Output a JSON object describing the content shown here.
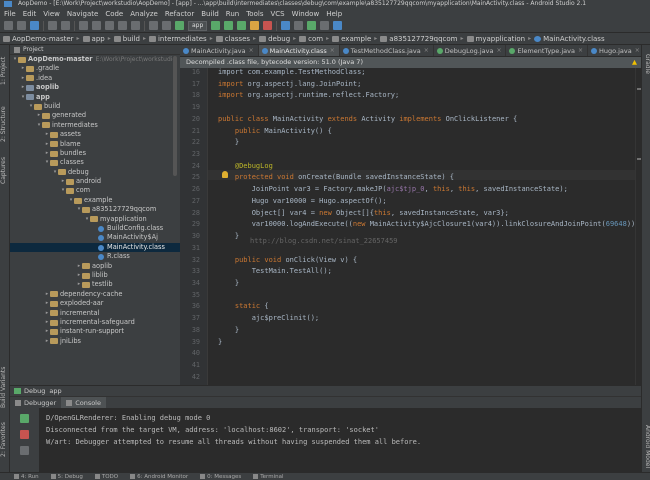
{
  "window": {
    "title": "AopDemo - [E:\\Work\\Project\\workstudio\\AopDemo] - [app] - ...\\app\\build\\intermediates\\classes\\debug\\com\\example\\a835127729qqcom\\myapplication\\MainActivity.class - Android Studio 2.1"
  },
  "menu": [
    "File",
    "Edit",
    "View",
    "Navigate",
    "Code",
    "Analyze",
    "Refactor",
    "Build",
    "Run",
    "Tools",
    "VCS",
    "Window",
    "Help"
  ],
  "toolbar": {
    "run_config": "app"
  },
  "breadcrumb": [
    {
      "label": "AopDemo-master",
      "icon": "folder-icon"
    },
    {
      "label": "app",
      "icon": "module-icon"
    },
    {
      "label": "build",
      "icon": "folder-icon"
    },
    {
      "label": "intermediates",
      "icon": "folder-icon"
    },
    {
      "label": "classes",
      "icon": "folder-icon"
    },
    {
      "label": "debug",
      "icon": "folder-icon"
    },
    {
      "label": "com",
      "icon": "folder-icon"
    },
    {
      "label": "example",
      "icon": "folder-icon"
    },
    {
      "label": "a835127729qqcom",
      "icon": "folder-icon"
    },
    {
      "label": "myapplication",
      "icon": "folder-icon"
    },
    {
      "label": "MainActivity.class",
      "icon": "class-icon"
    }
  ],
  "left_strip": {
    "tabs": [
      "1: Project",
      "2: Structure",
      "Captures",
      "Build Variants",
      "2: Favorites"
    ]
  },
  "right_strip": {
    "tabs": [
      "Gradle",
      "Android Model"
    ]
  },
  "project": {
    "header": "Project",
    "tree": [
      {
        "label": "AopDemo-master",
        "extra": "E:\\Work\\Project\\workstudio",
        "depth": 0,
        "open": true,
        "icon": "folder-icon"
      },
      {
        "label": ".gradle",
        "depth": 1,
        "open": false,
        "icon": "folder-icon"
      },
      {
        "label": ".idea",
        "depth": 1,
        "open": false,
        "icon": "folder-icon"
      },
      {
        "label": "aoplib",
        "depth": 1,
        "open": false,
        "icon": "module-icon"
      },
      {
        "label": "app",
        "depth": 1,
        "open": true,
        "icon": "module-icon"
      },
      {
        "label": "build",
        "depth": 2,
        "open": true,
        "icon": "folder-icon"
      },
      {
        "label": "generated",
        "depth": 3,
        "open": false,
        "icon": "folder-icon"
      },
      {
        "label": "intermediates",
        "depth": 3,
        "open": true,
        "icon": "folder-icon"
      },
      {
        "label": "assets",
        "depth": 4,
        "open": false,
        "icon": "folder-icon"
      },
      {
        "label": "blame",
        "depth": 4,
        "open": false,
        "icon": "folder-icon"
      },
      {
        "label": "bundles",
        "depth": 4,
        "open": false,
        "icon": "folder-icon"
      },
      {
        "label": "classes",
        "depth": 4,
        "open": true,
        "icon": "folder-icon"
      },
      {
        "label": "debug",
        "depth": 5,
        "open": true,
        "icon": "folder-icon"
      },
      {
        "label": "android",
        "depth": 6,
        "open": false,
        "icon": "folder-icon"
      },
      {
        "label": "com",
        "depth": 6,
        "open": true,
        "icon": "folder-icon"
      },
      {
        "label": "example",
        "depth": 7,
        "open": true,
        "icon": "folder-icon"
      },
      {
        "label": "a835127729qqcom",
        "depth": 8,
        "open": true,
        "icon": "folder-icon"
      },
      {
        "label": "myapplication",
        "depth": 9,
        "open": true,
        "icon": "folder-icon"
      },
      {
        "label": "BuildConfig.class",
        "depth": 10,
        "leaf": true,
        "icon": "class-icon"
      },
      {
        "label": "MainActivity$Aj",
        "depth": 10,
        "leaf": true,
        "icon": "class-icon"
      },
      {
        "label": "MainActivity.class",
        "depth": 10,
        "leaf": true,
        "icon": "class-icon",
        "selected": true
      },
      {
        "label": "R.class",
        "depth": 10,
        "leaf": true,
        "icon": "class-icon"
      },
      {
        "label": "aoplib",
        "depth": 8,
        "open": false,
        "icon": "folder-icon"
      },
      {
        "label": "liblib",
        "depth": 8,
        "open": false,
        "icon": "folder-icon"
      },
      {
        "label": "testlib",
        "depth": 8,
        "open": false,
        "icon": "folder-icon"
      },
      {
        "label": "dependency-cache",
        "depth": 4,
        "open": false,
        "icon": "folder-icon"
      },
      {
        "label": "exploded-aar",
        "depth": 4,
        "open": false,
        "icon": "folder-icon"
      },
      {
        "label": "incremental",
        "depth": 4,
        "open": false,
        "icon": "folder-icon"
      },
      {
        "label": "incremental-safeguard",
        "depth": 4,
        "open": false,
        "icon": "folder-icon"
      },
      {
        "label": "instant-run-support",
        "depth": 4,
        "open": false,
        "icon": "folder-icon"
      },
      {
        "label": "jniLibs",
        "depth": 4,
        "open": false,
        "icon": "folder-icon"
      }
    ]
  },
  "editor": {
    "tabs": [
      {
        "label": "MainActivity.java",
        "active": false,
        "color": "#4a88c7"
      },
      {
        "label": "MainActivity.class",
        "active": true,
        "color": "#4a88c7"
      },
      {
        "label": "TestMethodClass.java",
        "active": false,
        "color": "#4a88c7"
      },
      {
        "label": "DebugLog.java",
        "active": false,
        "color": "#59a869"
      },
      {
        "label": "ElementType.java",
        "active": false,
        "color": "#59a869"
      },
      {
        "label": "Hugo.java",
        "active": false,
        "color": "#4a88c7"
      }
    ],
    "notice": "Decompiled .class file, bytecode version: 51.0 (Java 7)",
    "line_numbers": [
      "16",
      "17",
      "18",
      "19",
      "20",
      "21",
      "22",
      "23",
      "24",
      "25",
      "26",
      "27",
      "28",
      "29",
      "30",
      "31",
      "32",
      "33",
      "34",
      "35",
      "36",
      "37",
      "38",
      "39",
      "40",
      "41",
      "42"
    ],
    "code_lines": [
      [
        {
          "t": "import com.example.TestMethodClass;",
          "c": ""
        }
      ],
      [
        {
          "t": "import ",
          "c": "kw"
        },
        {
          "t": "org.aspectj.lang.JoinPoint;",
          "c": ""
        }
      ],
      [
        {
          "t": "import ",
          "c": "kw"
        },
        {
          "t": "org.aspectj.runtime.reflect.Factory;",
          "c": ""
        }
      ],
      [],
      [
        {
          "t": "public class ",
          "c": "kw"
        },
        {
          "t": "MainActivity ",
          "c": ""
        },
        {
          "t": "extends ",
          "c": "kw"
        },
        {
          "t": "Activity ",
          "c": ""
        },
        {
          "t": "implements ",
          "c": "kw"
        },
        {
          "t": "OnClickListener {",
          "c": ""
        }
      ],
      [
        {
          "t": "    public ",
          "c": "kw"
        },
        {
          "t": "MainActivity() {",
          "c": ""
        }
      ],
      [
        {
          "t": "    }",
          "c": ""
        }
      ],
      [],
      [
        {
          "t": "    @DebugLog",
          "c": "an"
        }
      ],
      [
        {
          "t": "    protected void ",
          "c": "kw"
        },
        {
          "t": "onCreate(Bundle savedInstanceState) {",
          "c": ""
        }
      ],
      [
        {
          "t": "        JoinPoint var3 = Factory.makeJP(",
          "c": ""
        },
        {
          "t": "ajc$tjp_0",
          "c": "fld"
        },
        {
          "t": ", ",
          "c": ""
        },
        {
          "t": "this",
          "c": "kw"
        },
        {
          "t": ", ",
          "c": ""
        },
        {
          "t": "this",
          "c": "kw"
        },
        {
          "t": ", savedInstanceState);",
          "c": ""
        }
      ],
      [
        {
          "t": "        Hugo var10000 = Hugo.aspectOf();",
          "c": ""
        }
      ],
      [
        {
          "t": "        Object[] var4 = ",
          "c": ""
        },
        {
          "t": "new ",
          "c": "kw"
        },
        {
          "t": "Object[]{",
          "c": ""
        },
        {
          "t": "this",
          "c": "kw"
        },
        {
          "t": ", savedInstanceState, var3};",
          "c": ""
        }
      ],
      [
        {
          "t": "        var10000.logAndExecute((",
          "c": ""
        },
        {
          "t": "new ",
          "c": "kw"
        },
        {
          "t": "MainActivity$AjcClosure1(var4)).linkClosureAndJoinPoint(",
          "c": ""
        },
        {
          "t": "69648",
          "c": "num"
        },
        {
          "t": "));",
          "c": ""
        }
      ],
      [
        {
          "t": "    }",
          "c": ""
        }
      ],
      [],
      [
        {
          "t": "    public void ",
          "c": "kw"
        },
        {
          "t": "onClick(View v) {",
          "c": ""
        }
      ],
      [
        {
          "t": "        TestMain.TestAll();",
          "c": ""
        }
      ],
      [
        {
          "t": "    }",
          "c": ""
        }
      ],
      [],
      [
        {
          "t": "    static ",
          "c": "kw"
        },
        {
          "t": "{",
          "c": ""
        }
      ],
      [
        {
          "t": "        ajc$preClinit();",
          "c": ""
        }
      ],
      [
        {
          "t": "    }",
          "c": ""
        }
      ],
      [
        {
          "t": "}",
          "c": ""
        }
      ],
      [],
      [],
      []
    ],
    "watermark": "http://blog.csdn.net/sinat_22657459"
  },
  "debug": {
    "header": "Debug",
    "config": "app",
    "tabs": [
      "Debugger",
      "Console"
    ],
    "console_lines": [
      "D/OpenGLRenderer: Enabling debug mode 0",
      "Disconnected from the target VM, address: 'localhost:8602', transport: 'socket'",
      "W/art: Debugger attempted to resume all threads without having suspended them all before."
    ]
  },
  "statusbar": [
    "4: Run",
    "5: Debug",
    "TODO",
    "6: Android Monitor",
    "0: Messages",
    "Terminal"
  ],
  "colors": {
    "accent": "#4a88c7",
    "keyword": "#cc7832",
    "annotation": "#bbb529",
    "selection": "#0d293e"
  }
}
